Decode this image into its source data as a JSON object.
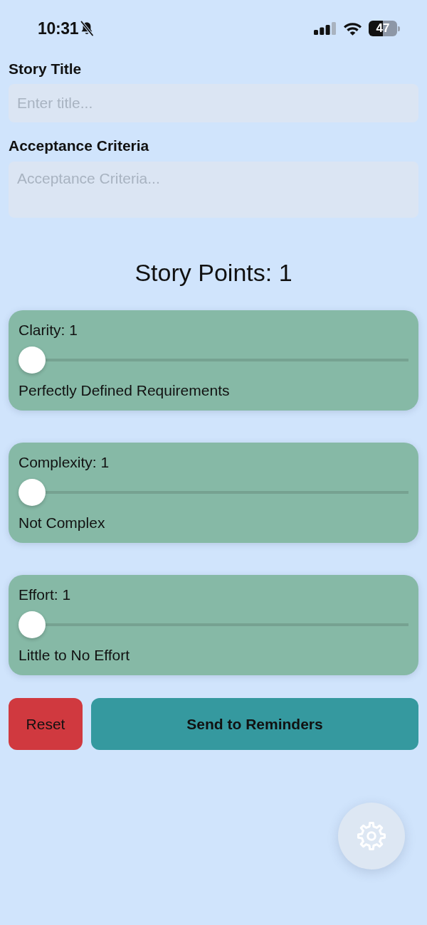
{
  "status_bar": {
    "time": "10:31",
    "silent": true,
    "battery": "47"
  },
  "fields": [
    {
      "label": "Story Title",
      "placeholder": "Enter title...",
      "kind": "line"
    },
    {
      "label": "Acceptance Criteria",
      "placeholder": "Acceptance Criteria...",
      "kind": "area"
    }
  ],
  "total": "Story Points: 1",
  "factors": [
    {
      "label": "Clarity: 1",
      "level": 0,
      "description": "Perfectly Defined Requirements"
    },
    {
      "label": "Complexity: 1",
      "level": 0,
      "description": "Not Complex"
    },
    {
      "label": "Effort: 1",
      "level": 0,
      "description": "Little to No Effort"
    }
  ],
  "buttons": [
    {
      "label": "Reset",
      "kind": "reset"
    },
    {
      "label": "Send to Reminders",
      "kind": "send"
    }
  ]
}
